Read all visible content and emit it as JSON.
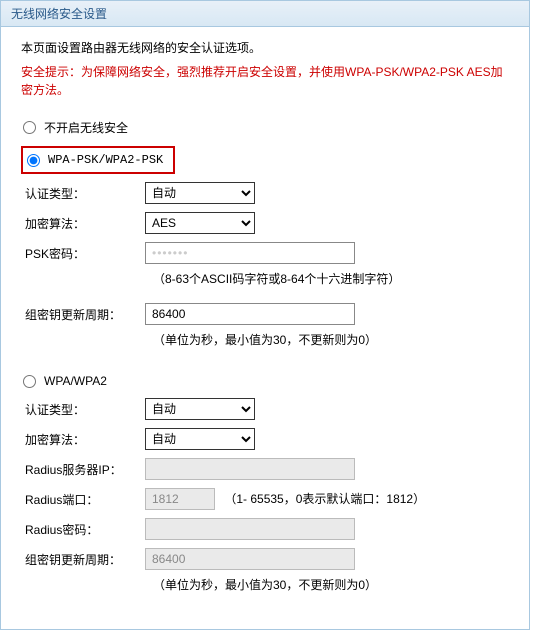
{
  "panel": {
    "title": "无线网络安全设置"
  },
  "intro": "本页面设置路由器无线网络的安全认证选项。",
  "tip": "安全提示：为保障网络安全，强烈推荐开启安全设置，并使用WPA-PSK/WPA2-PSK AES加密方法。",
  "options": {
    "none_label": "不开启无线安全",
    "wpapsk_label": "WPA-PSK/WPA2-PSK",
    "wpa_label": "WPA/WPA2"
  },
  "labels": {
    "auth": "认证类型：",
    "encrypt": "加密算法：",
    "psk": "PSK密码：",
    "group": "组密钥更新周期：",
    "radius_ip": "Radius服务器IP：",
    "radius_port": "Radius端口：",
    "radius_pw": "Radius密码："
  },
  "values": {
    "wpapsk": {
      "auth": "自动",
      "encrypt": "AES",
      "psk": "•••••••",
      "group": "86400"
    },
    "wpa": {
      "auth": "自动",
      "encrypt": "自动",
      "radius_ip": "",
      "radius_port": "1812",
      "radius_pw": "",
      "group": "86400"
    }
  },
  "hints": {
    "psk": "（8-63个ASCII码字符或8-64个十六进制字符）",
    "group": "（单位为秒，最小值为30，不更新则为0）",
    "radius_port": "（1- 65535，0表示默认端口：1812）"
  }
}
